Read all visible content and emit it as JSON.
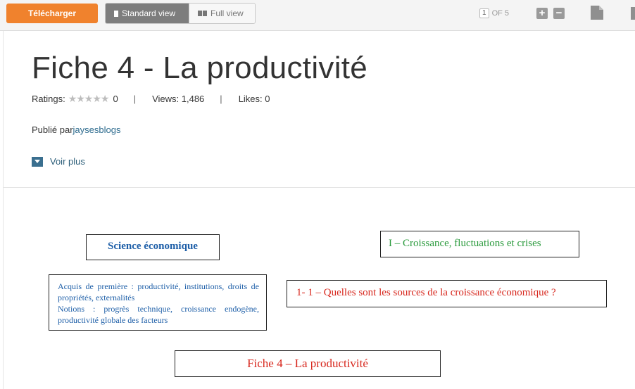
{
  "toolbar": {
    "download_label": "Télécharger",
    "standard_view_label": "Standard view",
    "full_view_label": "Full view",
    "current_page": "1",
    "page_of_label": "OF 5",
    "zoom_in_symbol": "+",
    "zoom_out_symbol": "−"
  },
  "header": {
    "title": "Fiche 4 - La productivité",
    "ratings_label": "Ratings:",
    "ratings_stars": "★★★★★",
    "ratings_value": "0",
    "views_label": "Views: 1,486",
    "likes_label": "Likes: 0",
    "published_prefix": "Publié par",
    "author": "jaysesblogs",
    "see_more_label": "Voir plus"
  },
  "document": {
    "science_box": "Science économique",
    "section_box": "I – Croissance, fluctuations et crises",
    "acquis_line1": "Acquis de première : productivité, institutions, droits de propriétés, externalités",
    "acquis_line2": "Notions : progrès technique, croissance endogène, productivité globale des facteurs",
    "question_box": "1- 1 – Quelles sont les sources de la croissance économique ?",
    "fiche_title_box": "Fiche 4 – La productivité"
  },
  "colors": {
    "download_button": "#f0822d",
    "active_view": "#7d7d7d",
    "link": "#2d6b8e",
    "doc_blue": "#1e5fa8",
    "doc_green": "#2a9a3c",
    "doc_red": "#d7261c"
  },
  "icons": {
    "zoom_in": "plus-icon",
    "zoom_out": "minus-icon",
    "document": "document-icon",
    "see_more": "chevron-down-icon"
  }
}
